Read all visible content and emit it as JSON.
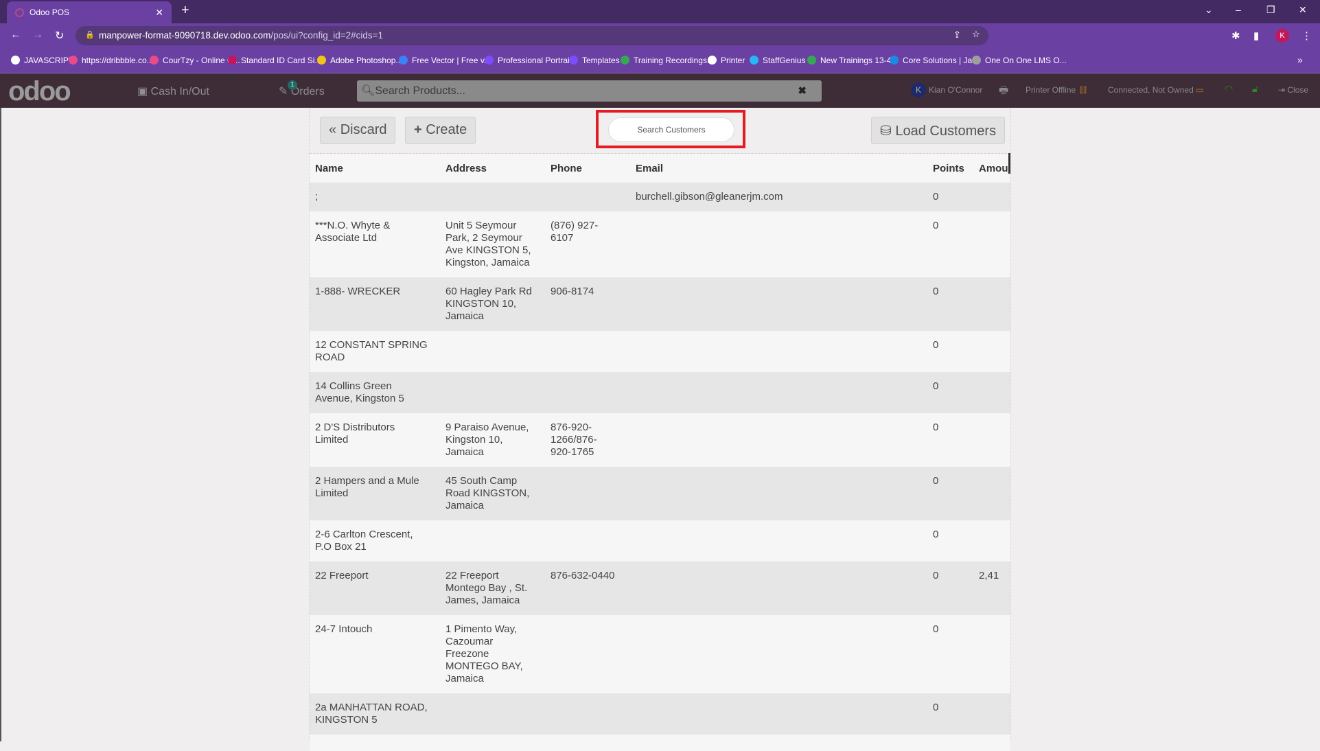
{
  "browser": {
    "tab_title": "Odoo POS",
    "url_host": "manpower-format-9090718.dev.odoo.com",
    "url_path": "/pos/ui?config_id=2#cids=1",
    "profile_initial": "K",
    "bookmarks": [
      "JAVASCRIPT",
      "https://dribbble.co...",
      "CourTzy - Online C...",
      "Standard ID Card Si...",
      "Adobe Photoshop...",
      "Free Vector | Free v...",
      "Professional Portrai...",
      "Templates",
      "Training Recordings...",
      "Printer",
      "StaffGenius",
      "New Trainings 13-4...",
      "Core Solutions | Ja...",
      "One On One LMS O..."
    ],
    "bookmark_colors": [
      "#ffffff",
      "#ea4c89",
      "#ea4c89",
      "#c2185b",
      "#f0c419",
      "#3b82f6",
      "#7c4dff",
      "#7c4dff",
      "#34a853",
      "#ffffff",
      "#29b6f6",
      "#34a853",
      "#1e88e5",
      "#9e9e9e"
    ]
  },
  "pos_header": {
    "logo": "odoo",
    "cash_label": "Cash In/Out",
    "orders_label": "Orders",
    "orders_count": "1",
    "search_placeholder": "Search Products...",
    "user_initial": "K",
    "user_name": "Kian O'Connor",
    "printer_status": "Printer Offline",
    "connection_status": "Connected, Not Owned",
    "close_label": "Close"
  },
  "customers": {
    "discard_label": "Discard",
    "create_label": "Create",
    "search_placeholder": "Search Customers",
    "load_label": "Load Customers",
    "columns": [
      "Name",
      "Address",
      "Phone",
      "Email",
      "Points",
      "Amou"
    ],
    "rows": [
      {
        "name": ";",
        "address": "",
        "phone": "",
        "email": "burchell.gibson@gleanerjm.com",
        "points": "0",
        "amount": ""
      },
      {
        "name": "***N.O. Whyte &\nAssociate Ltd",
        "address": "Unit 5 Seymour\nPark, 2 Seymour\nAve KINGSTON 5,\nKingston, Jamaica",
        "phone": "(876) 927-\n6107",
        "email": "",
        "points": "0",
        "amount": ""
      },
      {
        "name": "1-888- WRECKER",
        "address": "60 Hagley Park Rd\nKINGSTON 10,\nJamaica",
        "phone": "906-8174",
        "email": "",
        "points": "0",
        "amount": ""
      },
      {
        "name": "12 CONSTANT SPRING\nROAD",
        "address": "",
        "phone": "",
        "email": "",
        "points": "0",
        "amount": ""
      },
      {
        "name": "14 Collins Green\nAvenue, Kingston 5",
        "address": "",
        "phone": "",
        "email": "",
        "points": "0",
        "amount": ""
      },
      {
        "name": "2 D'S Distributors\nLimited",
        "address": "9 Paraiso Avenue,\nKingston 10,\nJamaica",
        "phone": "876-920-\n1266/876-\n920-1765",
        "email": "",
        "points": "0",
        "amount": ""
      },
      {
        "name": "2 Hampers and a Mule\nLimited",
        "address": "45 South Camp\nRoad KINGSTON,\nJamaica",
        "phone": "",
        "email": "",
        "points": "0",
        "amount": ""
      },
      {
        "name": "2-6 Carlton Crescent,\nP.O Box 21",
        "address": "",
        "phone": "",
        "email": "",
        "points": "0",
        "amount": ""
      },
      {
        "name": "22 Freeport",
        "address": "22 Freeport\nMontego Bay , St.\nJames, Jamaica",
        "phone": "876-632-0440",
        "email": "",
        "points": "0",
        "amount": "2,41"
      },
      {
        "name": "24-7 Intouch",
        "address": "1 Pimento Way,\nCazoumar\nFreezone\nMONTEGO BAY,\nJamaica",
        "phone": "",
        "email": "",
        "points": "0",
        "amount": ""
      },
      {
        "name": "2a MANHATTAN ROAD,\nKINGSTON 5",
        "address": "",
        "phone": "",
        "email": "",
        "points": "0",
        "amount": ""
      },
      {
        "name": "",
        "address": "",
        "phone": "",
        "email": "",
        "points": "",
        "amount": ""
      }
    ]
  }
}
